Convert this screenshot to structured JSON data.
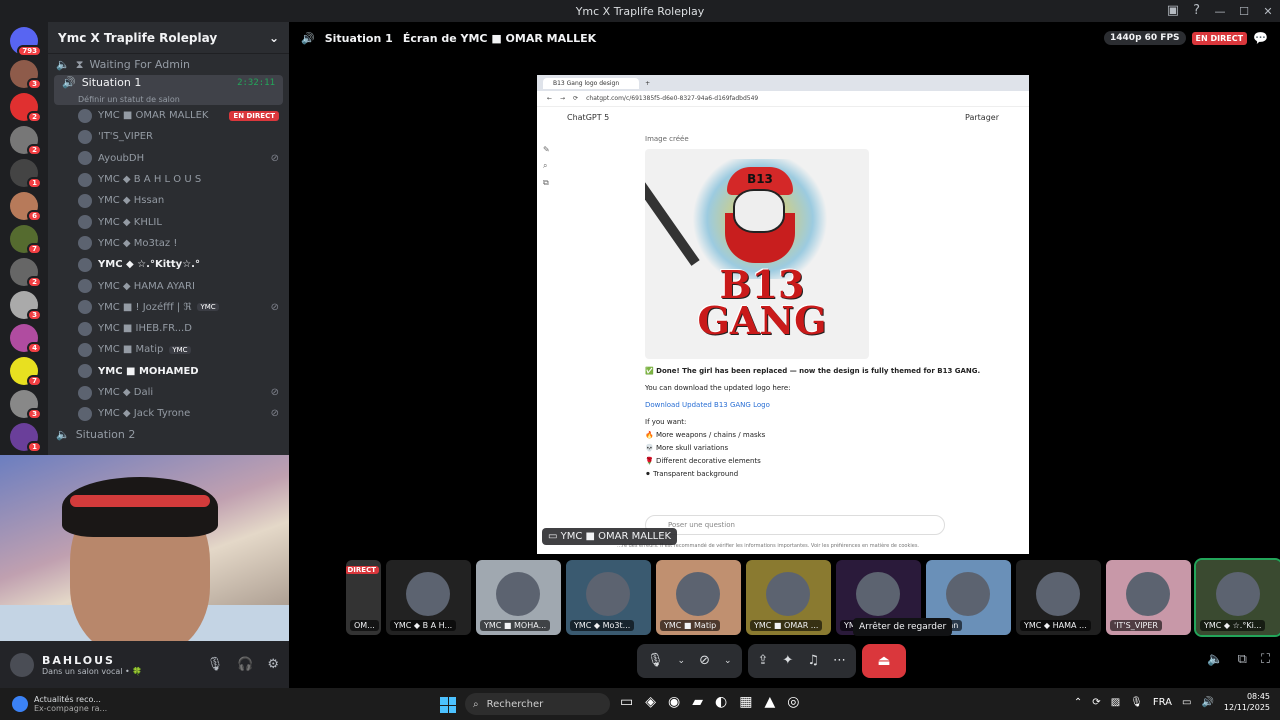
{
  "window": {
    "title": "Ymc X Traplife Roleplay"
  },
  "servers": [
    {
      "badge": "793",
      "color": "#5865f2"
    },
    {
      "badge": "3",
      "color": "#8e5b4a"
    },
    {
      "badge": "2",
      "color": "#e03030"
    },
    {
      "badge": "2",
      "color": "#777777"
    },
    {
      "badge": "1",
      "color": "#444444"
    },
    {
      "badge": "6",
      "color": "#b77a5a"
    },
    {
      "badge": "7",
      "color": "#556b2f"
    },
    {
      "badge": "2",
      "color": "#666666"
    },
    {
      "badge": "3",
      "color": "#aaaaaa"
    },
    {
      "badge": "4",
      "color": "#b04ca0"
    },
    {
      "badge": "7",
      "color": "#e8e020"
    },
    {
      "badge": "3",
      "color": "#888888"
    },
    {
      "badge": "1",
      "color": "#6a3f9a"
    }
  ],
  "guild": {
    "name": "Ymc X Traplife Roleplay"
  },
  "channels": {
    "waiting": "Waiting For Admin",
    "situation1": {
      "name": "Situation 1",
      "time": "2:32:11",
      "status": "Définir un statut de salon"
    },
    "situation2": "Situation 2",
    "live_label": "EN DIRECT"
  },
  "voice_users": [
    {
      "name": "YMC ■ OMAR MALLEK",
      "live": true
    },
    {
      "name": "'IT'S_VIPER"
    },
    {
      "name": "AyoubDH",
      "muted": true
    },
    {
      "name": "YMC ◆ B A H L O U S"
    },
    {
      "name": "YMC ◆ Hssan"
    },
    {
      "name": "YMC ◆ KHLIL"
    },
    {
      "name": "YMC ◆ Mo3taz !"
    },
    {
      "name": "YMC ◆ ☆.°Kitty☆.°",
      "bright": true
    },
    {
      "name": "YMC ◆ HAMA AYARI"
    },
    {
      "name": "YMC ■ ! Jozéfff | ℜ",
      "tag": "YMC",
      "muted": true
    },
    {
      "name": "YMC ■ IHEB.FR...D"
    },
    {
      "name": "YMC ■ Matip",
      "tag": "YMC"
    },
    {
      "name": "YMC ■ MOHAMED",
      "bright": true
    },
    {
      "name": "YMC ◆ Dali",
      "muted": true
    },
    {
      "name": "YMC ◆ Jack Tyrone",
      "muted": true
    }
  ],
  "userbar": {
    "name": "BAHLOUS",
    "status": "Dans un salon vocal • 🍀"
  },
  "stage": {
    "channel": "Situation 1",
    "stream_title": "Écran de YMC ■ OMAR MALLEK",
    "quality": "1440p 60 FPS",
    "live": "EN DIRECT"
  },
  "browser": {
    "tab": "B13 Gang logo design",
    "url": "chatgpt.com/c/691385f5-d6e0-8327-94a6-d169fadbd549",
    "app": "ChatGPT 5",
    "share": "Partager",
    "image_label": "Image créée",
    "logo_text": "B13\nGANG",
    "cap_text": "B13",
    "done_msg": "✅ Done! The girl has been replaced — now the design is fully themed for B13 GANG.",
    "download_intro": "You can download the updated logo here:",
    "download_link": "Download Updated B13 GANG Logo",
    "if_you_want": "If you want:",
    "options": [
      "🔥 More weapons / chains / masks",
      "💀 More skull variations",
      "🌹 Different decorative elements",
      "⚫ Transparent background"
    ],
    "ask_placeholder": "Poser une question",
    "disclaimer": "…re des erreurs. Il est recommandé de vérifier les informations importantes. Voir les préférences en matière de cookies."
  },
  "screen_label": "YMC ■ OMAR MALLEK",
  "tiles": [
    {
      "label": "OM...",
      "direct": "DIRECT",
      "color": "#333333"
    },
    {
      "label": "YMC ◆ B A H...",
      "color": "#222222"
    },
    {
      "label": "YMC ■ MOHA...",
      "color": "#a0a8b0"
    },
    {
      "label": "YMC ◆ Mo3t...",
      "color": "#3a5a70"
    },
    {
      "label": "YMC ■ Matip",
      "color": "#c09070"
    },
    {
      "label": "YMC ■ OMAR ...",
      "color": "#8a7a30"
    },
    {
      "label": "YMC",
      "color": "#2a1a3a"
    },
    {
      "label": "Hssan",
      "color": "#6a90b8"
    },
    {
      "label": "YMC ◆ HAMA ...",
      "color": "#202020"
    },
    {
      "label": "'IT'S_VIPER",
      "color": "#c898a8"
    },
    {
      "label": "YMC ◆ ☆.°Ki...",
      "color": "#3a4a30",
      "active": true
    }
  ],
  "tooltip": "Arrêter de regarder",
  "taskbar": {
    "news_title": "Actualités reco...",
    "news_sub": "Ex-compagne ra...",
    "search": "Rechercher",
    "lang": "FRA",
    "time": "08:45",
    "date": "12/11/2025"
  }
}
